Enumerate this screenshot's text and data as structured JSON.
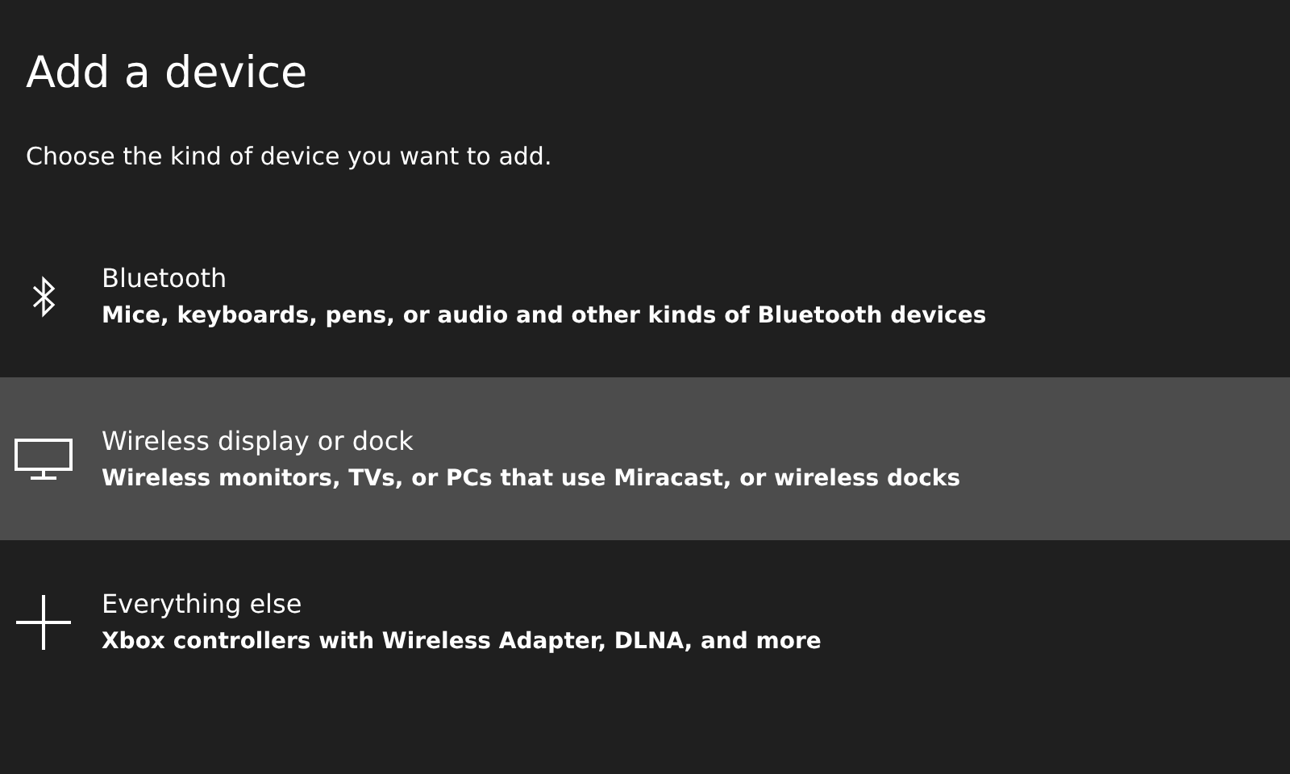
{
  "title": "Add a device",
  "subtitle": "Choose the kind of device you want to add.",
  "options": [
    {
      "kind": "bluetooth",
      "name": "Bluetooth",
      "description": "Mice, keyboards, pens, or audio and other kinds of Bluetooth devices",
      "selected": false
    },
    {
      "kind": "display",
      "name": "Wireless display or dock",
      "description": "Wireless monitors, TVs, or PCs that use Miracast, or wireless docks",
      "selected": true
    },
    {
      "kind": "other",
      "name": "Everything else",
      "description": "Xbox controllers with Wireless Adapter, DLNA, and more",
      "selected": false
    }
  ]
}
